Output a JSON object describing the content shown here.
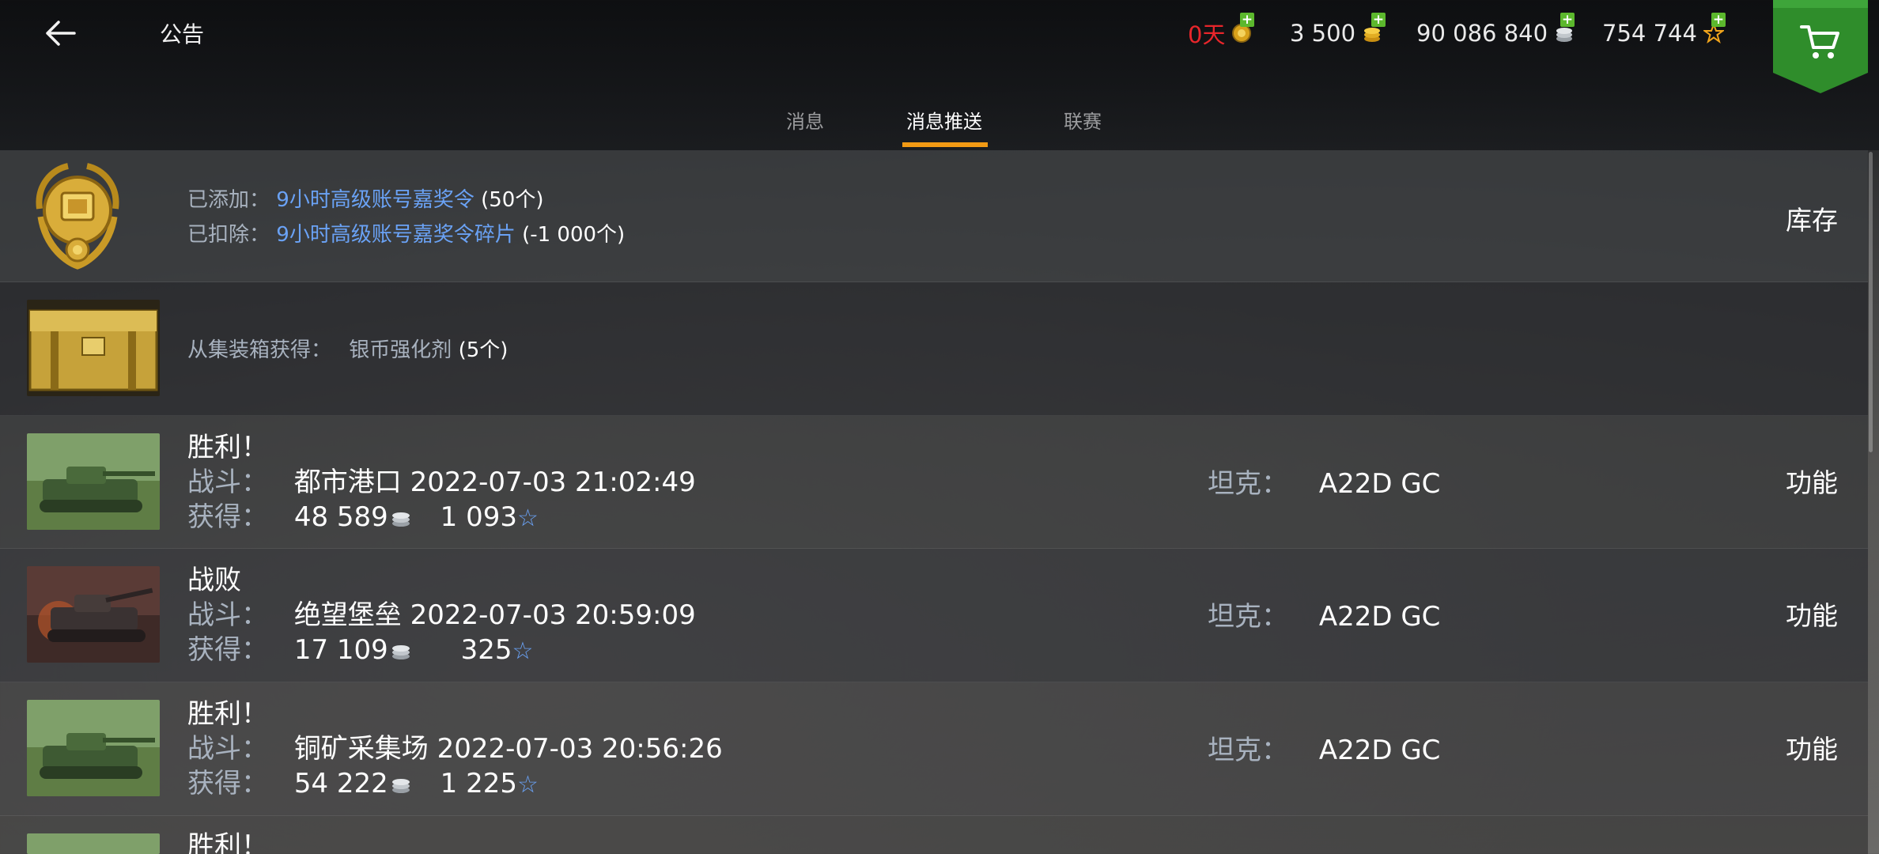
{
  "header": {
    "title": "公告",
    "resources": {
      "premium_days": "0天",
      "gold": "3 500",
      "credits": "90 086 840",
      "free_xp": "754 744",
      "plus": "+"
    },
    "colors": {
      "premium_days": "#e8262b",
      "tab_accent": "#f29a14",
      "shop_green": "#2e8b2a",
      "link_blue": "#6aa2f5"
    }
  },
  "tabs": [
    {
      "label": "消息",
      "active": false
    },
    {
      "label": "消息推送",
      "active": true
    },
    {
      "label": "联赛",
      "active": false
    }
  ],
  "notifications": {
    "added": {
      "added_label": "已添加：",
      "added_item": "9小时高级账号嘉奖令",
      "added_qty": "(50个)",
      "removed_label": "已扣除：",
      "removed_item": "9小时高级账号嘉奖令碎片",
      "removed_qty": "(-1 000个)",
      "action": "库存"
    },
    "container": {
      "label": "从集装箱获得：",
      "item": "银币强化剂",
      "qty": "(5个)"
    },
    "battles": [
      {
        "result": "胜利！",
        "battle_label": "战斗：",
        "map": "都市港口",
        "datetime": "2022-07-03 21:02:49",
        "earn_label": "获得：",
        "credits": "48 589",
        "xp": "1 093",
        "tank_label": "坦克：",
        "tank": "A22D GC",
        "action": "功能",
        "thumb": "victory"
      },
      {
        "result": "战败",
        "battle_label": "战斗：",
        "map": "绝望堡垒",
        "datetime": "2022-07-03 20:59:09",
        "earn_label": "获得：",
        "credits": "17 109",
        "xp": "325",
        "tank_label": "坦克：",
        "tank": "A22D GC",
        "action": "功能",
        "thumb": "defeat"
      },
      {
        "result": "胜利！",
        "battle_label": "战斗：",
        "map": "铜矿采集场",
        "datetime": "2022-07-03 20:56:26",
        "earn_label": "获得：",
        "credits": "54 222",
        "xp": "1 225",
        "tank_label": "坦克：",
        "tank": "A22D GC",
        "action": "功能",
        "thumb": "victory"
      },
      {
        "result": "胜利！",
        "thumb": "victory"
      }
    ],
    "star_glyph": "☆"
  }
}
